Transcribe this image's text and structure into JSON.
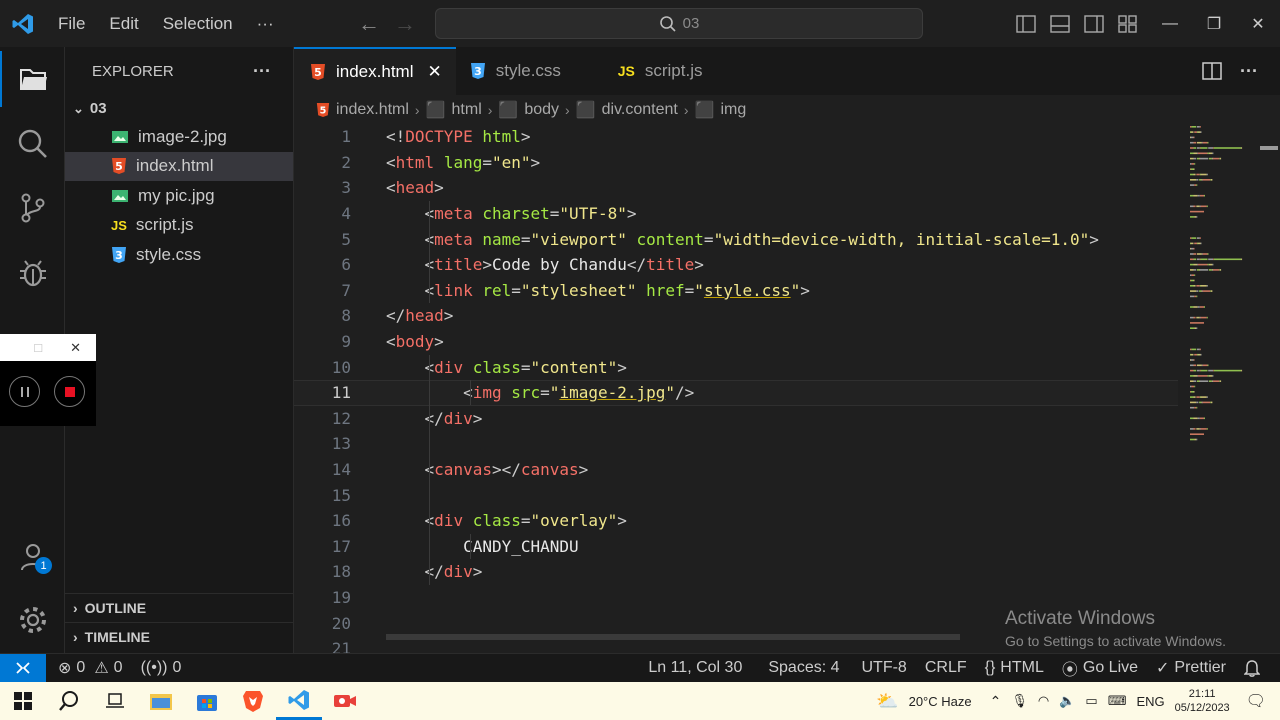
{
  "titlebar": {
    "menu": [
      "File",
      "Edit",
      "Selection",
      "···"
    ],
    "search_text": "03",
    "win_min": "—",
    "win_max": "❐",
    "win_close": "✕"
  },
  "activity": {
    "accounts_badge": "1"
  },
  "sidebar": {
    "title": "EXPLORER",
    "more": "···",
    "folder": "03",
    "files": [
      {
        "name": "image-2.jpg",
        "icon": "image-file-icon"
      },
      {
        "name": "index.html",
        "icon": "html-file-icon"
      },
      {
        "name": "my pic.jpg",
        "icon": "image-file-icon"
      },
      {
        "name": "script.js",
        "icon": "js-file-icon"
      },
      {
        "name": "style.css",
        "icon": "css-file-icon"
      }
    ],
    "outline": "OUTLINE",
    "timeline": "TIMELINE"
  },
  "recorder": {
    "close": "✕"
  },
  "tabs": [
    {
      "label": "index.html",
      "close": "✕"
    },
    {
      "label": "style.css"
    },
    {
      "label": "script.js"
    }
  ],
  "breadcrumbs": [
    "index.html",
    "html",
    "body",
    "div.content",
    "img"
  ],
  "editor": {
    "line_numbers": [
      "1",
      "2",
      "3",
      "4",
      "5",
      "6",
      "7",
      "8",
      "9",
      "10",
      "11",
      "12",
      "13",
      "14",
      "15",
      "16",
      "17",
      "18",
      "19",
      "20",
      "21"
    ],
    "lines": [
      [
        [
          "p",
          "<!"
        ],
        [
          "dt",
          "DOCTYPE"
        ],
        [
          "p",
          " "
        ],
        [
          "attr",
          "html"
        ],
        [
          "p",
          ">"
        ]
      ],
      [
        [
          "p",
          "<"
        ],
        [
          "tag",
          "html"
        ],
        [
          "p",
          " "
        ],
        [
          "attr",
          "lang"
        ],
        [
          "p",
          "="
        ],
        [
          "str",
          "\"en\""
        ],
        [
          "p",
          ">"
        ]
      ],
      [
        [
          "p",
          "<"
        ],
        [
          "tag",
          "head"
        ],
        [
          "p",
          ">"
        ]
      ],
      [
        [
          "p",
          "    <"
        ],
        [
          "tag",
          "meta"
        ],
        [
          "p",
          " "
        ],
        [
          "attr",
          "charset"
        ],
        [
          "p",
          "="
        ],
        [
          "str",
          "\"UTF-8\""
        ],
        [
          "p",
          ">"
        ]
      ],
      [
        [
          "p",
          "    <"
        ],
        [
          "tag",
          "meta"
        ],
        [
          "p",
          " "
        ],
        [
          "attr",
          "name"
        ],
        [
          "p",
          "="
        ],
        [
          "str",
          "\"viewport\""
        ],
        [
          "p",
          " "
        ],
        [
          "attr",
          "content"
        ],
        [
          "p",
          "="
        ],
        [
          "str",
          "\"width=device-width, initial-scale=1.0\""
        ],
        [
          "p",
          ">"
        ]
      ],
      [
        [
          "p",
          "    <"
        ],
        [
          "tag",
          "title"
        ],
        [
          "p",
          ">"
        ],
        [
          "txt",
          "Code by Chandu"
        ],
        [
          "p",
          "</"
        ],
        [
          "tag",
          "title"
        ],
        [
          "p",
          ">"
        ]
      ],
      [
        [
          "p",
          "    <"
        ],
        [
          "tag",
          "link"
        ],
        [
          "p",
          " "
        ],
        [
          "attr",
          "rel"
        ],
        [
          "p",
          "="
        ],
        [
          "str",
          "\"stylesheet\""
        ],
        [
          "p",
          " "
        ],
        [
          "attr",
          "href"
        ],
        [
          "p",
          "="
        ],
        [
          "str",
          "\""
        ],
        [
          "stru",
          "style.css"
        ],
        [
          "str",
          "\""
        ],
        [
          "p",
          ">"
        ]
      ],
      [
        [
          "p",
          "</"
        ],
        [
          "tag",
          "head"
        ],
        [
          "p",
          ">"
        ]
      ],
      [
        [
          "p",
          "<"
        ],
        [
          "tag",
          "body"
        ],
        [
          "p",
          ">"
        ]
      ],
      [
        [
          "p",
          "    <"
        ],
        [
          "tag",
          "div"
        ],
        [
          "p",
          " "
        ],
        [
          "attr",
          "class"
        ],
        [
          "p",
          "="
        ],
        [
          "str",
          "\"content\""
        ],
        [
          "p",
          ">"
        ]
      ],
      [
        [
          "p",
          "        <"
        ],
        [
          "tag",
          "img"
        ],
        [
          "p",
          " "
        ],
        [
          "attr",
          "src"
        ],
        [
          "p",
          "="
        ],
        [
          "str",
          "\""
        ],
        [
          "stru",
          "image-2.jpg"
        ],
        [
          "str",
          "\""
        ],
        [
          "p",
          "/>"
        ]
      ],
      [
        [
          "p",
          "    </"
        ],
        [
          "tag",
          "div"
        ],
        [
          "p",
          ">"
        ]
      ],
      [],
      [
        [
          "p",
          "    <"
        ],
        [
          "tag",
          "canvas"
        ],
        [
          "p",
          "></"
        ],
        [
          "tag",
          "canvas"
        ],
        [
          "p",
          ">"
        ]
      ],
      [],
      [
        [
          "p",
          "    <"
        ],
        [
          "tag",
          "div"
        ],
        [
          "p",
          " "
        ],
        [
          "attr",
          "class"
        ],
        [
          "p",
          "="
        ],
        [
          "str",
          "\"overlay\""
        ],
        [
          "p",
          ">"
        ]
      ],
      [
        [
          "txt",
          "        CANDY_CHANDU"
        ]
      ],
      [
        [
          "p",
          "    </"
        ],
        [
          "tag",
          "div"
        ],
        [
          "p",
          ">"
        ]
      ],
      [],
      [],
      []
    ],
    "current_line": 11
  },
  "watermark": {
    "title": "Activate Windows",
    "subtitle": "Go to Settings to activate Windows."
  },
  "statusbar": {
    "errors": "0",
    "warnings": "0",
    "ports": "0",
    "position": "Ln 11, Col 30",
    "spaces": "Spaces: 4",
    "encoding": "UTF-8",
    "eol": "CRLF",
    "language": "HTML",
    "golive": "Go Live",
    "prettier": "Prettier"
  },
  "taskbar": {
    "weather": "20°C  Haze",
    "lang": "ENG",
    "time": "21:11",
    "date": "05/12/2023"
  },
  "colors": {
    "accent": "#0078d4",
    "tag": "#f47067",
    "attr": "#a5e844",
    "string": "#f0e68c"
  }
}
